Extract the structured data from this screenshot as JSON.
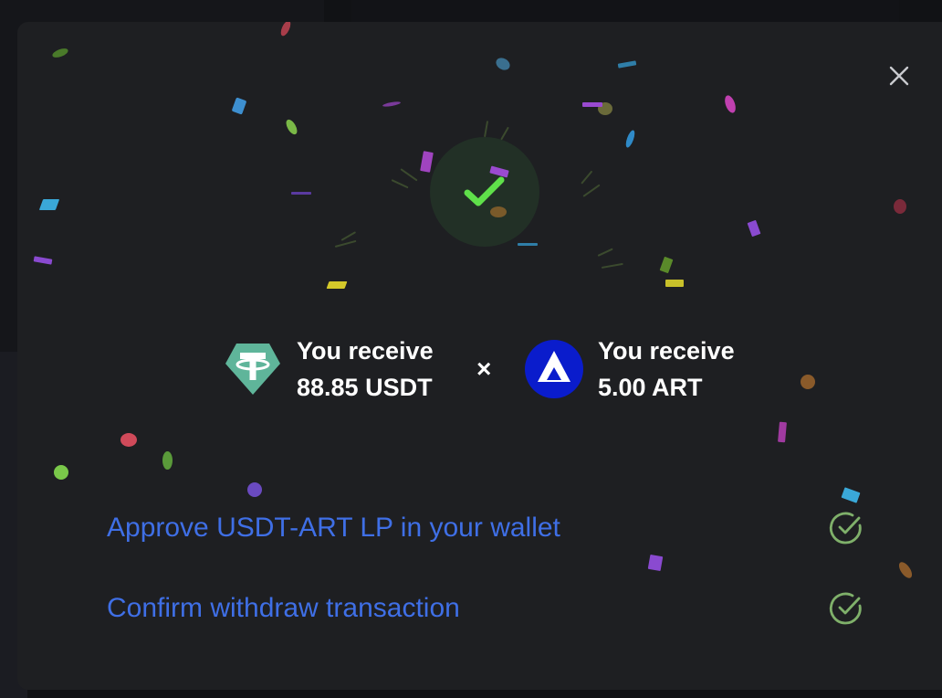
{
  "modal": {
    "close_icon": "close-icon",
    "success_icon": "checkmark-icon",
    "receive": [
      {
        "label": "You receive",
        "amount": "88.85 USDT",
        "icon": "tether-icon",
        "color": "#5fb59a"
      },
      {
        "label": "You receive",
        "amount": "5.00 ART",
        "icon": "art-token-icon",
        "color": "#0a1ccc"
      }
    ],
    "separator": "×",
    "steps": [
      {
        "label": "Approve USDT-ART LP in your wallet",
        "status": "done"
      },
      {
        "label": "Confirm withdraw transaction",
        "status": "done"
      }
    ]
  },
  "colors": {
    "accent": "#3f6fe6",
    "success": "#5fe04a",
    "step_check": "#7fb06a",
    "modal_bg": "#1e1f22"
  }
}
